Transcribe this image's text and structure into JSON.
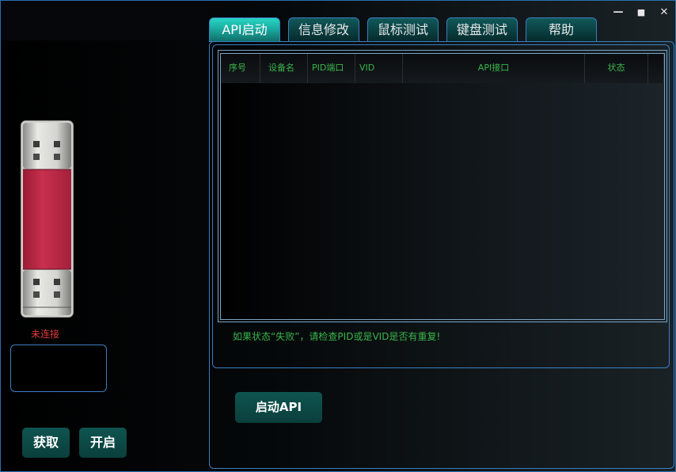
{
  "window": {
    "minimize": "—",
    "maximize": "■",
    "close": "✕"
  },
  "tabs": [
    {
      "label": "API启动",
      "active": true
    },
    {
      "label": "信息修改",
      "active": false
    },
    {
      "label": "鼠标测试",
      "active": false
    },
    {
      "label": "键盘测试",
      "active": false
    },
    {
      "label": "帮助",
      "active": false
    }
  ],
  "table": {
    "columns": [
      "序号",
      "设备名",
      "PID端口",
      "VID",
      "API接口",
      "状态"
    ],
    "rows": []
  },
  "warning": "如果状态“失败”，请检查PID或是VID是否有重复!",
  "buttons": {
    "start_api": "启动API",
    "get": "获取",
    "open": "开启"
  },
  "device": {
    "icon": "usb-drive-icon",
    "status": "未连接",
    "status_color": "#e03a3a"
  },
  "colors": {
    "accent_border": "#3a7fc0",
    "text_green": "#39b54a",
    "button_teal": "#0f5450"
  }
}
